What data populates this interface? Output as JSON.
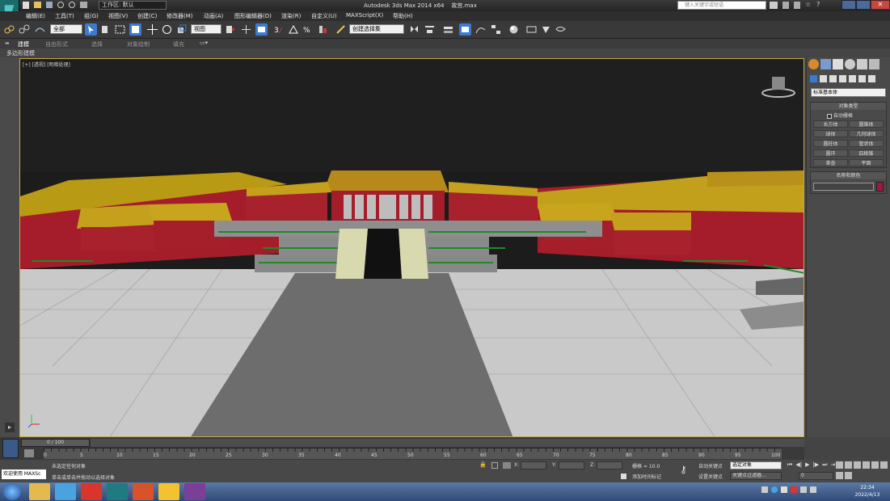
{
  "window": {
    "title": "Autodesk 3ds Max  2014 x64",
    "filename": "故宫.max",
    "workspace": "工作区: 默认",
    "search_placeholder": "键入关键字或短语"
  },
  "menu": [
    "编辑(E)",
    "工具(T)",
    "组(G)",
    "视图(V)",
    "创建(C)",
    "修改器(M)",
    "动画(A)",
    "图形编辑器(D)",
    "渲染(R)",
    "自定义(U)",
    "MAXScript(X)",
    "帮助(H)"
  ],
  "toolbar": {
    "filter_value": "全部",
    "coord_value": "视图",
    "selset_value": "创建选择集"
  },
  "ribbon": {
    "tabs": [
      "建模",
      "自由形式",
      "选择",
      "对象绘制",
      "填充"
    ],
    "subtab": "多边形建模"
  },
  "viewport": {
    "label": "[+] [透视] [明暗处理]"
  },
  "command_panel": {
    "category": "标准基本体",
    "rollout1": "对象类型",
    "autogrid": "自动栅格",
    "buttons": [
      "长方体",
      "圆锥体",
      "球体",
      "几何球体",
      "圆柱体",
      "管状体",
      "圆环",
      "四棱锥",
      "茶壶",
      "平面"
    ],
    "rollout2": "名称和颜色",
    "swatch_color": "#a0183c"
  },
  "timeline": {
    "frame_display": "0 / 100",
    "ticks": [
      "0",
      "5",
      "10",
      "15",
      "20",
      "25",
      "30",
      "35",
      "40",
      "45",
      "50",
      "55",
      "60",
      "65",
      "70",
      "75",
      "80",
      "85",
      "90",
      "95",
      "100"
    ]
  },
  "status": {
    "welcome": "欢迎使用 MAXSc",
    "line1": "未选定任何对象",
    "line2": "单击或单击并拖动以选择对象",
    "x_label": "X:",
    "y_label": "Y:",
    "z_label": "Z:",
    "grid": "栅格 = 10.0",
    "add_time_tag": "添加时间标记",
    "auto_key": "自动关键点",
    "set_key": "设置关键点",
    "key_mode_select": "选定对象",
    "key_filter": "关键点过滤器...",
    "frame": "0"
  },
  "taskbar": {
    "time": "22:34",
    "date": "2022/4/13"
  }
}
